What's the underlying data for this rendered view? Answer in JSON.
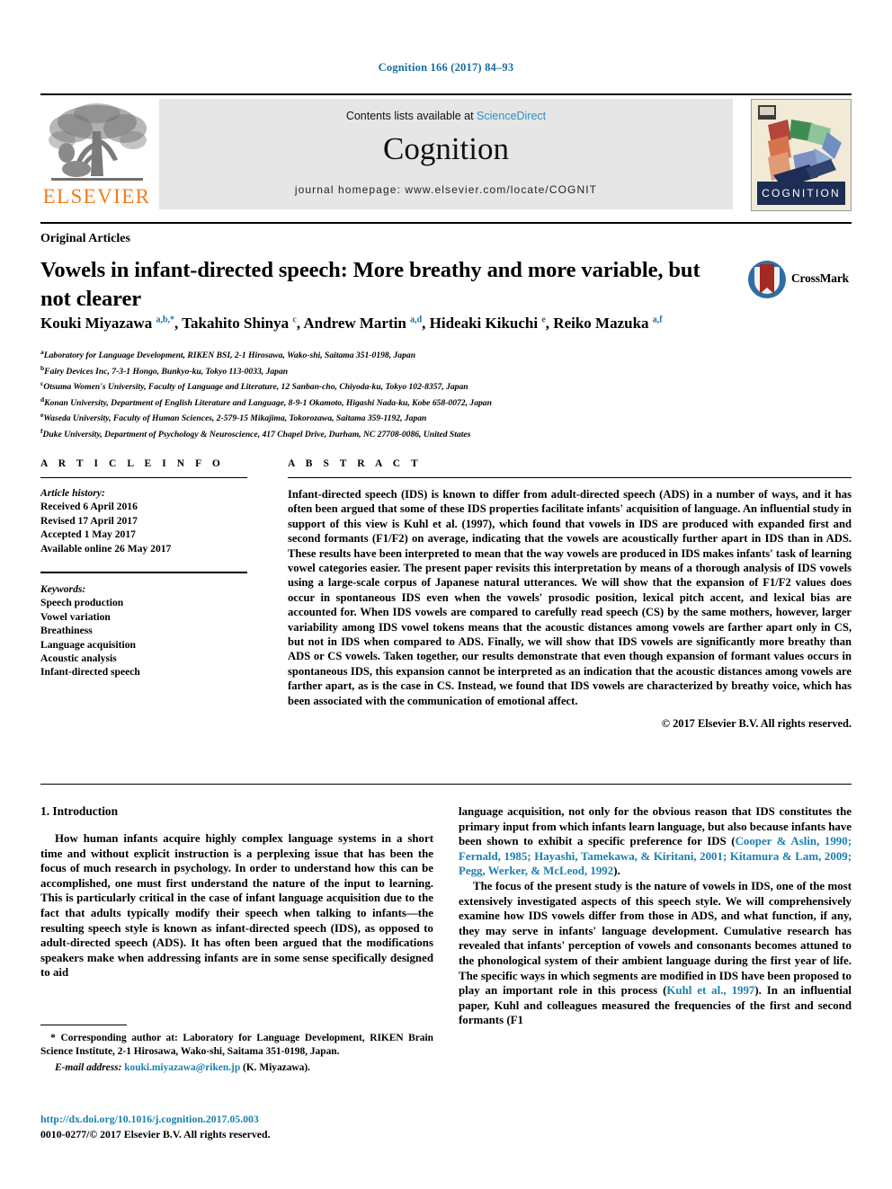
{
  "running_head": "Cognition 166 (2017) 84–93",
  "masthead": {
    "contents_prefix": "Contents lists available at ",
    "contents_link": "ScienceDirect",
    "journal_title": "Cognition",
    "homepage": "journal homepage: www.elsevier.com/locate/COGNIT",
    "publisher_wordmark": "ELSEVIER",
    "cover_label": "COGNITION",
    "publisher_logo_icon": "elsevier-tree-icon",
    "cover_icon": "cognition-cover-icon"
  },
  "article": {
    "category": "Original Articles",
    "title": "Vowels in infant-directed speech: More breathy and more variable, but not clearer",
    "crossmark_label": "CrossMark",
    "crossmark_icon": "crossmark-badge-icon",
    "authors_html": "Kouki Miyazawa <sup>a,b,*</sup>, Takahito Shinya <sup>c</sup>, Andrew Martin <sup>a,d</sup>, Hideaki Kikuchi <sup>e</sup>, Reiko Mazuka <sup>a,f</sup>",
    "affiliations": [
      {
        "marker": "a",
        "text": "Laboratory for Language Development, RIKEN BSI, 2-1 Hirosawa, Wako-shi, Saitama 351-0198, Japan"
      },
      {
        "marker": "b",
        "text": "Fairy Devices Inc, 7-3-1 Hongo, Bunkyo-ku, Tokyo 113-0033, Japan"
      },
      {
        "marker": "c",
        "text": "Otsuma Women's University, Faculty of Language and Literature, 12 Sanban-cho, Chiyoda-ku, Tokyo 102-8357, Japan"
      },
      {
        "marker": "d",
        "text": "Konan University, Department of English Literature and Language, 8-9-1 Okamoto, Higashi Nada-ku, Kobe 658-0072, Japan"
      },
      {
        "marker": "e",
        "text": "Waseda University, Faculty of Human Sciences, 2-579-15 Mikajima, Tokorozawa, Saitama 359-1192, Japan"
      },
      {
        "marker": "f",
        "text": "Duke University, Department of Psychology & Neuroscience, 417 Chapel Drive, Durham, NC 27708-0086, United States"
      }
    ]
  },
  "article_info": {
    "heading": "A R T I C L E   I N F O",
    "history_label": "Article history:",
    "history": [
      "Received 6 April 2016",
      "Revised 17 April 2017",
      "Accepted 1 May 2017",
      "Available online 26 May 2017"
    ],
    "keywords_label": "Keywords:",
    "keywords": [
      "Speech production",
      "Vowel variation",
      "Breathiness",
      "Language acquisition",
      "Acoustic analysis",
      "Infant-directed speech"
    ]
  },
  "abstract": {
    "heading": "A B S T R A C T",
    "text": "Infant-directed speech (IDS) is known to differ from adult-directed speech (ADS) in a number of ways, and it has often been argued that some of these IDS properties facilitate infants' acquisition of language. An influential study in support of this view is Kuhl et al. (1997), which found that vowels in IDS are produced with expanded first and second formants (F1/F2) on average, indicating that the vowels are acoustically further apart in IDS than in ADS. These results have been interpreted to mean that the way vowels are produced in IDS makes infants' task of learning vowel categories easier. The present paper revisits this interpretation by means of a thorough analysis of IDS vowels using a large-scale corpus of Japanese natural utterances. We will show that the expansion of F1/F2 values does occur in spontaneous IDS even when the vowels' prosodic position, lexical pitch accent, and lexical bias are accounted for. When IDS vowels are compared to carefully read speech (CS) by the same mothers, however, larger variability among IDS vowel tokens means that the acoustic distances among vowels are farther apart only in CS, but not in IDS when compared to ADS. Finally, we will show that IDS vowels are significantly more breathy than ADS or CS vowels. Taken together, our results demonstrate that even though expansion of formant values occurs in spontaneous IDS, this expansion cannot be interpreted as an indication that the acoustic distances among vowels are farther apart, as is the case in CS. Instead, we found that IDS vowels are characterized by breathy voice, which has been associated with the communication of emotional affect.",
    "copyright": "© 2017 Elsevier B.V. All rights reserved."
  },
  "introduction": {
    "heading": "1. Introduction",
    "left_paragraph": "How human infants acquire highly complex language systems in a short time and without explicit instruction is a perplexing issue that has been the focus of much research in psychology. In order to understand how this can be accomplished, one must first understand the nature of the input to learning. This is particularly critical in the case of infant language acquisition due to the fact that adults typically modify their speech when talking to infants—the resulting speech style is known as infant-directed speech (IDS), as opposed to adult-directed speech (ADS). It has often been argued that the modifications speakers make when addressing infants are in some sense specifically designed to aid",
    "right_paragraph_1_before": "language acquisition, not only for the obvious reason that IDS constitutes the primary input from which infants learn language, but also because infants have been shown to exhibit a specific preference for IDS (",
    "right_paragraph_1_citation": "Cooper & Aslin, 1990; Fernald, 1985; Hayashi, Tamekawa, & Kiritani, 2001; Kitamura & Lam, 2009; Pegg, Werker, & McLeod, 1992",
    "right_paragraph_1_after": ").",
    "right_paragraph_2_before": "The focus of the present study is the nature of vowels in IDS, one of the most extensively investigated aspects of this speech style. We will comprehensively examine how IDS vowels differ from those in ADS, and what function, if any, they may serve in infants' language development. Cumulative research has revealed that infants' perception of vowels and consonants becomes attuned to the phonological system of their ambient language during the first year of life. The specific ways in which segments are modified in IDS have been proposed to play an important role in this process (",
    "right_paragraph_2_citation": "Kuhl et al., 1997",
    "right_paragraph_2_after": "). In an influential paper, Kuhl and colleagues measured the frequencies of the first and second formants (F1"
  },
  "footnotes": {
    "corresponding_marker": "*",
    "corresponding_text": "Corresponding author at: Laboratory for Language Development, RIKEN Brain Science Institute, 2-1 Hirosawa, Wako-shi, Saitama 351-0198, Japan.",
    "email_label": "E-mail address:",
    "email": "kouki.miyazawa@riken.jp",
    "email_suffix": "(K. Miyazawa)."
  },
  "imprint": {
    "doi": "http://dx.doi.org/10.1016/j.cognition.2017.05.003",
    "issn_line": "0010-0277/© 2017 Elsevier B.V. All rights reserved."
  },
  "colors": {
    "link_blue": "#1a7fae",
    "header_blue": "#1a6c9c",
    "elsevier_orange": "#ef7d1a",
    "masthead_gray": "#e6e6e6",
    "cover_navy": "#1e2d54"
  }
}
